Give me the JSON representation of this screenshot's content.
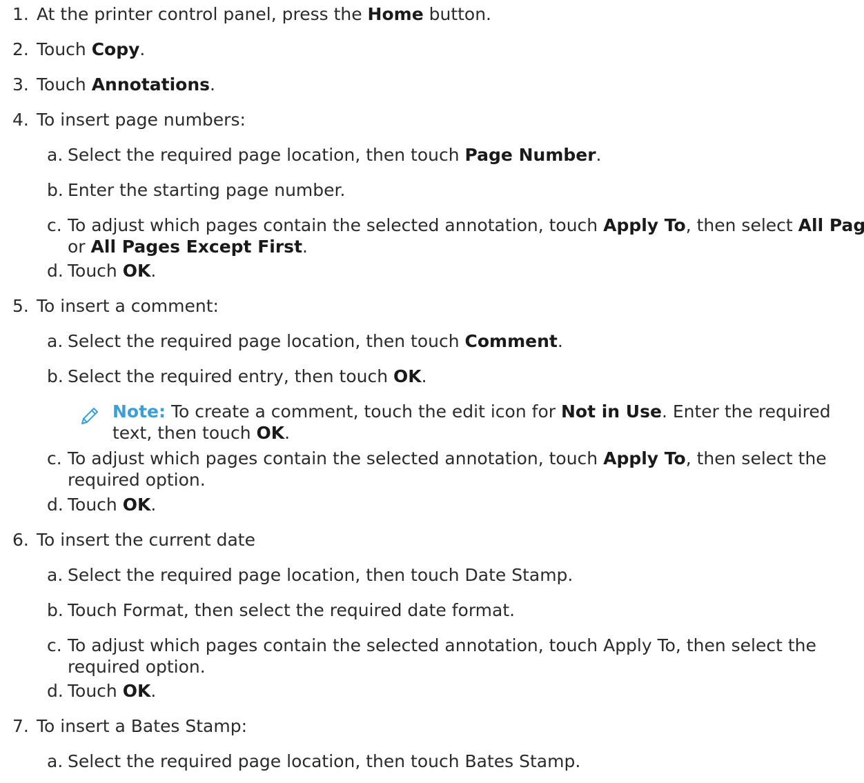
{
  "steps": [
    {
      "num": "1.",
      "segments": [
        {
          "t": "At the printer control panel, press the "
        },
        {
          "t": "Home",
          "b": true
        },
        {
          "t": " button."
        }
      ]
    },
    {
      "num": "2.",
      "segments": [
        {
          "t": "Touch "
        },
        {
          "t": "Copy",
          "b": true
        },
        {
          "t": "."
        }
      ]
    },
    {
      "num": "3.",
      "segments": [
        {
          "t": "Touch "
        },
        {
          "t": "Annotations",
          "b": true
        },
        {
          "t": "."
        }
      ]
    },
    {
      "num": "4.",
      "segments": [
        {
          "t": "To insert page numbers:"
        }
      ]
    },
    {
      "num": "5.",
      "segments": [
        {
          "t": "To insert a comment:"
        }
      ]
    },
    {
      "num": "6.",
      "segments": [
        {
          "t": "To insert the current date"
        }
      ]
    },
    {
      "num": "7.",
      "segments": [
        {
          "t": "To insert a Bates Stamp:"
        }
      ]
    }
  ],
  "substeps": {
    "4a": {
      "letter": "a.",
      "segments": [
        {
          "t": "Select the required page location, then touch "
        },
        {
          "t": "Page Number",
          "b": true
        },
        {
          "t": "."
        }
      ]
    },
    "4b": {
      "letter": "b.",
      "segments": [
        {
          "t": "Enter the starting page number."
        }
      ]
    },
    "4c": {
      "letter": "c.",
      "lines": [
        [
          {
            "t": "To adjust which pages contain the selected annotation, touch "
          },
          {
            "t": "Apply To",
            "b": true
          },
          {
            "t": ", then select "
          },
          {
            "t": "All Pages",
            "b": true
          }
        ],
        [
          {
            "t": "or "
          },
          {
            "t": "All Pages Except First",
            "b": true
          },
          {
            "t": "."
          }
        ]
      ]
    },
    "4d": {
      "letter": "d.",
      "segments": [
        {
          "t": "Touch "
        },
        {
          "t": "OK",
          "b": true
        },
        {
          "t": "."
        }
      ]
    },
    "5a": {
      "letter": "a.",
      "segments": [
        {
          "t": "Select the required page location, then touch "
        },
        {
          "t": "Comment",
          "b": true
        },
        {
          "t": "."
        }
      ]
    },
    "5b": {
      "letter": "b.",
      "segments": [
        {
          "t": "Select the required entry, then touch "
        },
        {
          "t": "OK",
          "b": true
        },
        {
          "t": "."
        }
      ]
    },
    "5c": {
      "letter": "c.",
      "lines": [
        [
          {
            "t": "To adjust which pages contain the selected annotation, touch "
          },
          {
            "t": "Apply To",
            "b": true
          },
          {
            "t": ", then select the"
          }
        ],
        [
          {
            "t": "required option."
          }
        ]
      ]
    },
    "5d": {
      "letter": "d.",
      "segments": [
        {
          "t": "Touch "
        },
        {
          "t": "OK",
          "b": true
        },
        {
          "t": "."
        }
      ]
    },
    "6a": {
      "letter": "a.",
      "segments": [
        {
          "t": "Select the required page location, then touch Date Stamp."
        }
      ]
    },
    "6b": {
      "letter": "b.",
      "segments": [
        {
          "t": "Touch Format, then select the required date format."
        }
      ]
    },
    "6c": {
      "letter": "c.",
      "lines": [
        [
          {
            "t": "To adjust which pages contain the selected annotation, touch Apply To, then select the"
          }
        ],
        [
          {
            "t": "required option."
          }
        ]
      ]
    },
    "6d": {
      "letter": "d.",
      "segments": [
        {
          "t": "Touch "
        },
        {
          "t": "OK",
          "b": true
        },
        {
          "t": "."
        }
      ]
    },
    "7a": {
      "letter": "a.",
      "segments": [
        {
          "t": "Select the required page location, then touch Bates Stamp."
        }
      ]
    }
  },
  "note": {
    "icon": "pencil-icon",
    "label": "Note:",
    "lines": [
      [
        {
          "t": " To create a comment, touch the edit icon for "
        },
        {
          "t": "Not in Use",
          "b": true
        },
        {
          "t": ". Enter the required"
        }
      ],
      [
        {
          "t": "text, then touch "
        },
        {
          "t": "OK",
          "b": true
        },
        {
          "t": "."
        }
      ]
    ]
  },
  "colors": {
    "text": "#2b2b2b",
    "note_label": "#3a9fd8",
    "icon": "#3a9fd8"
  }
}
